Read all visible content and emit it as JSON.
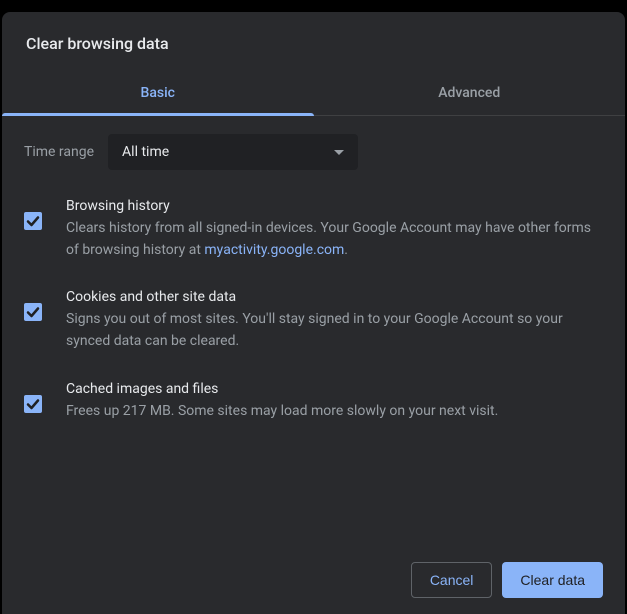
{
  "dialog": {
    "title": "Clear browsing data"
  },
  "tabs": {
    "basic": "Basic",
    "advanced": "Advanced"
  },
  "timerange": {
    "label": "Time range",
    "selected": "All time"
  },
  "options": {
    "browsing_history": {
      "title": "Browsing history",
      "desc_prefix": "Clears history from all signed-in devices. Your Google Account may have other forms of browsing history at ",
      "desc_link": "myactivity.google.com",
      "desc_suffix": "."
    },
    "cookies": {
      "title": "Cookies and other site data",
      "desc": "Signs you out of most sites. You'll stay signed in to your Google Account so your synced data can be cleared."
    },
    "cache": {
      "title": "Cached images and files",
      "desc": "Frees up 217 MB. Some sites may load more slowly on your next visit."
    }
  },
  "buttons": {
    "cancel": "Cancel",
    "clear": "Clear data"
  }
}
